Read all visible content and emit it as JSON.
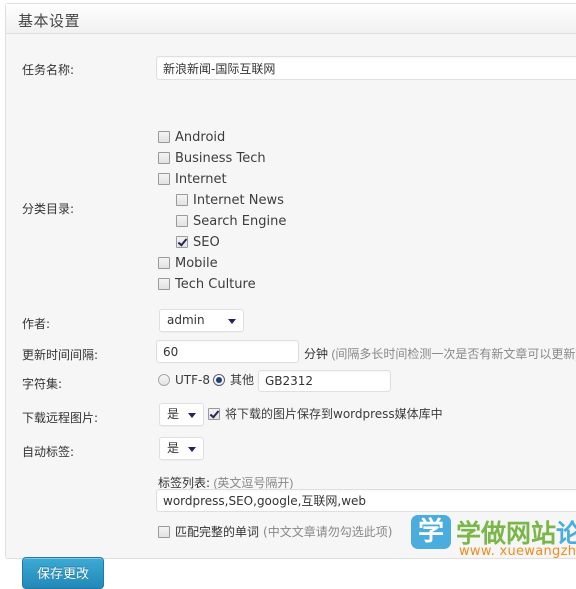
{
  "panel": {
    "title": "基本设置"
  },
  "fields": {
    "task_name": {
      "label": "任务名称:",
      "value": "新浪新闻-国际互联网"
    },
    "category": {
      "label": "分类目录:",
      "items": [
        {
          "label": "Android",
          "checked": false,
          "level": 0
        },
        {
          "label": "Business Tech",
          "checked": false,
          "level": 0
        },
        {
          "label": "Internet",
          "checked": false,
          "level": 0
        },
        {
          "label": "Internet News",
          "checked": false,
          "level": 1
        },
        {
          "label": "Search Engine",
          "checked": false,
          "level": 1
        },
        {
          "label": "SEO",
          "checked": true,
          "level": 1
        },
        {
          "label": "Mobile",
          "checked": false,
          "level": 0
        },
        {
          "label": "Tech Culture",
          "checked": false,
          "level": 0
        }
      ]
    },
    "author": {
      "label": "作者:",
      "value": "admin"
    },
    "interval": {
      "label": "更新时间间隔:",
      "value": "60",
      "unit": "分钟",
      "hint": "(间隔多长时间检测一次是否有新文章可以更新)"
    },
    "charset": {
      "label": "字符集:",
      "option_utf8": "UTF-8",
      "option_other": "其他",
      "selected": "其他",
      "other_value": "GB2312"
    },
    "download_image": {
      "label": "下载远程图片:",
      "value": "是",
      "save_to_media_label": "将下载的图片保存到wordpress媒体库中",
      "save_to_media_checked": true
    },
    "auto_tag": {
      "label": "自动标签:",
      "value": "是"
    },
    "tags": {
      "label": "标签列表:",
      "hint": "(英文逗号隔开)",
      "value": "wordpress,SEO,google,互联网,web",
      "whole_word_label": "匹配完整的单词",
      "whole_word_hint": "(中文文章请勿勾选此项)",
      "whole_word_checked": false
    }
  },
  "actions": {
    "save_label": "保存更改"
  },
  "watermark": {
    "badge": "学",
    "name_green": "学做网站",
    "name_blue": "论坛",
    "url": "www. xuewangzhan. net"
  }
}
